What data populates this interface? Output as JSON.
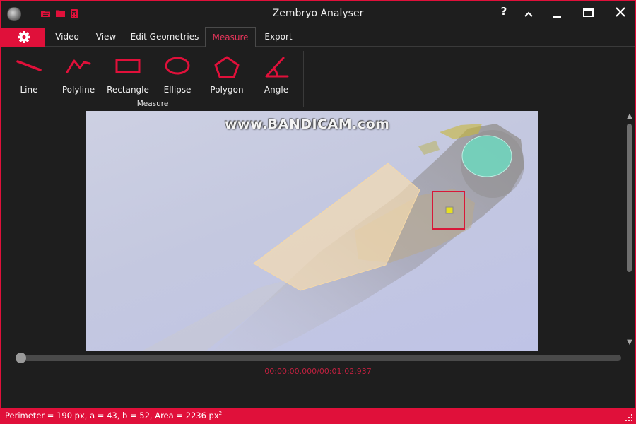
{
  "window": {
    "title": "Zembryo Analyser"
  },
  "quick_access": [
    {
      "icon": "open-folder-icon"
    },
    {
      "icon": "folder-icon"
    },
    {
      "icon": "calculator-icon"
    }
  ],
  "window_controls": {
    "help": "?",
    "collapse_ribbon": "^",
    "minimize": "—",
    "maximize": "☐",
    "close": "✕"
  },
  "tabs": [
    {
      "label": "Video"
    },
    {
      "label": "View"
    },
    {
      "label": "Edit Geometries"
    },
    {
      "label": "Measure",
      "active": true
    },
    {
      "label": "Export"
    }
  ],
  "ribbon": {
    "group_label": "Measure",
    "tools": [
      {
        "label": "Line",
        "icon": "line-tool-icon"
      },
      {
        "label": "Polyline",
        "icon": "polyline-tool-icon"
      },
      {
        "label": "Rectangle",
        "icon": "rectangle-tool-icon"
      },
      {
        "label": "Ellipse",
        "icon": "ellipse-tool-icon"
      },
      {
        "label": "Polygon",
        "icon": "polygon-tool-icon"
      },
      {
        "label": "Angle",
        "icon": "angle-tool-icon"
      }
    ]
  },
  "viewport": {
    "watermark": "www.BANDICAM.com"
  },
  "timeline": {
    "timecode": "00:00:00.000/00:01:02.937",
    "progress": 0.0
  },
  "status": {
    "measurement": "Perimeter = 190 px, a = 43, b = 52, Area = 2236 px",
    "area_exponent": "2"
  },
  "colors": {
    "accent": "#e0103a",
    "background": "#1e1e1e",
    "polygon_fill": "#f5dcb0",
    "ellipse_fill": "#6fd8c0",
    "selection_box": "#d81838",
    "point_marker": "#e8e020"
  }
}
